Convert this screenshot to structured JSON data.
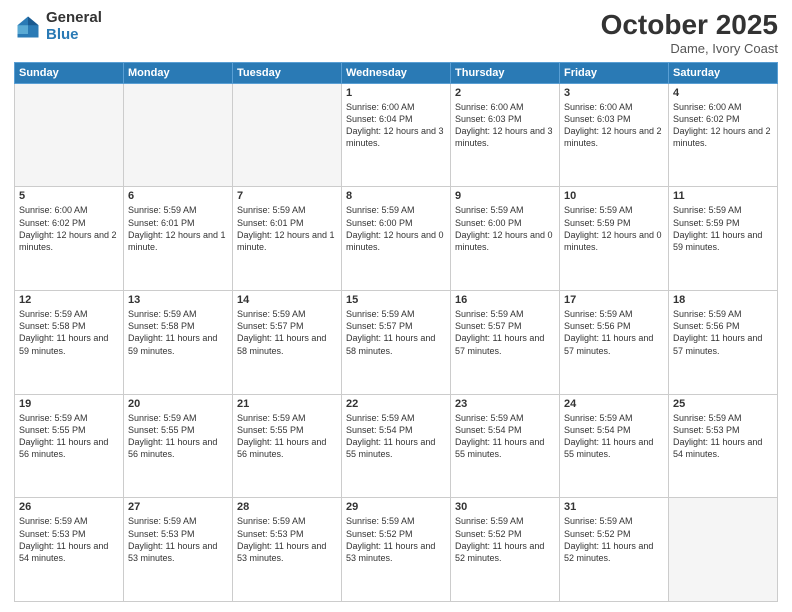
{
  "header": {
    "logo_general": "General",
    "logo_blue": "Blue",
    "month": "October 2025",
    "location": "Dame, Ivory Coast"
  },
  "days_of_week": [
    "Sunday",
    "Monday",
    "Tuesday",
    "Wednesday",
    "Thursday",
    "Friday",
    "Saturday"
  ],
  "weeks": [
    [
      {
        "day": "",
        "empty": true
      },
      {
        "day": "",
        "empty": true
      },
      {
        "day": "",
        "empty": true
      },
      {
        "day": "1",
        "sunrise": "Sunrise: 6:00 AM",
        "sunset": "Sunset: 6:04 PM",
        "daylight": "Daylight: 12 hours and 3 minutes."
      },
      {
        "day": "2",
        "sunrise": "Sunrise: 6:00 AM",
        "sunset": "Sunset: 6:03 PM",
        "daylight": "Daylight: 12 hours and 3 minutes."
      },
      {
        "day": "3",
        "sunrise": "Sunrise: 6:00 AM",
        "sunset": "Sunset: 6:03 PM",
        "daylight": "Daylight: 12 hours and 2 minutes."
      },
      {
        "day": "4",
        "sunrise": "Sunrise: 6:00 AM",
        "sunset": "Sunset: 6:02 PM",
        "daylight": "Daylight: 12 hours and 2 minutes."
      }
    ],
    [
      {
        "day": "5",
        "sunrise": "Sunrise: 6:00 AM",
        "sunset": "Sunset: 6:02 PM",
        "daylight": "Daylight: 12 hours and 2 minutes."
      },
      {
        "day": "6",
        "sunrise": "Sunrise: 5:59 AM",
        "sunset": "Sunset: 6:01 PM",
        "daylight": "Daylight: 12 hours and 1 minute."
      },
      {
        "day": "7",
        "sunrise": "Sunrise: 5:59 AM",
        "sunset": "Sunset: 6:01 PM",
        "daylight": "Daylight: 12 hours and 1 minute."
      },
      {
        "day": "8",
        "sunrise": "Sunrise: 5:59 AM",
        "sunset": "Sunset: 6:00 PM",
        "daylight": "Daylight: 12 hours and 0 minutes."
      },
      {
        "day": "9",
        "sunrise": "Sunrise: 5:59 AM",
        "sunset": "Sunset: 6:00 PM",
        "daylight": "Daylight: 12 hours and 0 minutes."
      },
      {
        "day": "10",
        "sunrise": "Sunrise: 5:59 AM",
        "sunset": "Sunset: 5:59 PM",
        "daylight": "Daylight: 12 hours and 0 minutes."
      },
      {
        "day": "11",
        "sunrise": "Sunrise: 5:59 AM",
        "sunset": "Sunset: 5:59 PM",
        "daylight": "Daylight: 11 hours and 59 minutes."
      }
    ],
    [
      {
        "day": "12",
        "sunrise": "Sunrise: 5:59 AM",
        "sunset": "Sunset: 5:58 PM",
        "daylight": "Daylight: 11 hours and 59 minutes."
      },
      {
        "day": "13",
        "sunrise": "Sunrise: 5:59 AM",
        "sunset": "Sunset: 5:58 PM",
        "daylight": "Daylight: 11 hours and 59 minutes."
      },
      {
        "day": "14",
        "sunrise": "Sunrise: 5:59 AM",
        "sunset": "Sunset: 5:57 PM",
        "daylight": "Daylight: 11 hours and 58 minutes."
      },
      {
        "day": "15",
        "sunrise": "Sunrise: 5:59 AM",
        "sunset": "Sunset: 5:57 PM",
        "daylight": "Daylight: 11 hours and 58 minutes."
      },
      {
        "day": "16",
        "sunrise": "Sunrise: 5:59 AM",
        "sunset": "Sunset: 5:57 PM",
        "daylight": "Daylight: 11 hours and 57 minutes."
      },
      {
        "day": "17",
        "sunrise": "Sunrise: 5:59 AM",
        "sunset": "Sunset: 5:56 PM",
        "daylight": "Daylight: 11 hours and 57 minutes."
      },
      {
        "day": "18",
        "sunrise": "Sunrise: 5:59 AM",
        "sunset": "Sunset: 5:56 PM",
        "daylight": "Daylight: 11 hours and 57 minutes."
      }
    ],
    [
      {
        "day": "19",
        "sunrise": "Sunrise: 5:59 AM",
        "sunset": "Sunset: 5:55 PM",
        "daylight": "Daylight: 11 hours and 56 minutes."
      },
      {
        "day": "20",
        "sunrise": "Sunrise: 5:59 AM",
        "sunset": "Sunset: 5:55 PM",
        "daylight": "Daylight: 11 hours and 56 minutes."
      },
      {
        "day": "21",
        "sunrise": "Sunrise: 5:59 AM",
        "sunset": "Sunset: 5:55 PM",
        "daylight": "Daylight: 11 hours and 56 minutes."
      },
      {
        "day": "22",
        "sunrise": "Sunrise: 5:59 AM",
        "sunset": "Sunset: 5:54 PM",
        "daylight": "Daylight: 11 hours and 55 minutes."
      },
      {
        "day": "23",
        "sunrise": "Sunrise: 5:59 AM",
        "sunset": "Sunset: 5:54 PM",
        "daylight": "Daylight: 11 hours and 55 minutes."
      },
      {
        "day": "24",
        "sunrise": "Sunrise: 5:59 AM",
        "sunset": "Sunset: 5:54 PM",
        "daylight": "Daylight: 11 hours and 55 minutes."
      },
      {
        "day": "25",
        "sunrise": "Sunrise: 5:59 AM",
        "sunset": "Sunset: 5:53 PM",
        "daylight": "Daylight: 11 hours and 54 minutes."
      }
    ],
    [
      {
        "day": "26",
        "sunrise": "Sunrise: 5:59 AM",
        "sunset": "Sunset: 5:53 PM",
        "daylight": "Daylight: 11 hours and 54 minutes."
      },
      {
        "day": "27",
        "sunrise": "Sunrise: 5:59 AM",
        "sunset": "Sunset: 5:53 PM",
        "daylight": "Daylight: 11 hours and 53 minutes."
      },
      {
        "day": "28",
        "sunrise": "Sunrise: 5:59 AM",
        "sunset": "Sunset: 5:53 PM",
        "daylight": "Daylight: 11 hours and 53 minutes."
      },
      {
        "day": "29",
        "sunrise": "Sunrise: 5:59 AM",
        "sunset": "Sunset: 5:52 PM",
        "daylight": "Daylight: 11 hours and 53 minutes."
      },
      {
        "day": "30",
        "sunrise": "Sunrise: 5:59 AM",
        "sunset": "Sunset: 5:52 PM",
        "daylight": "Daylight: 11 hours and 52 minutes."
      },
      {
        "day": "31",
        "sunrise": "Sunrise: 5:59 AM",
        "sunset": "Sunset: 5:52 PM",
        "daylight": "Daylight: 11 hours and 52 minutes."
      },
      {
        "day": "",
        "empty": true
      }
    ]
  ]
}
